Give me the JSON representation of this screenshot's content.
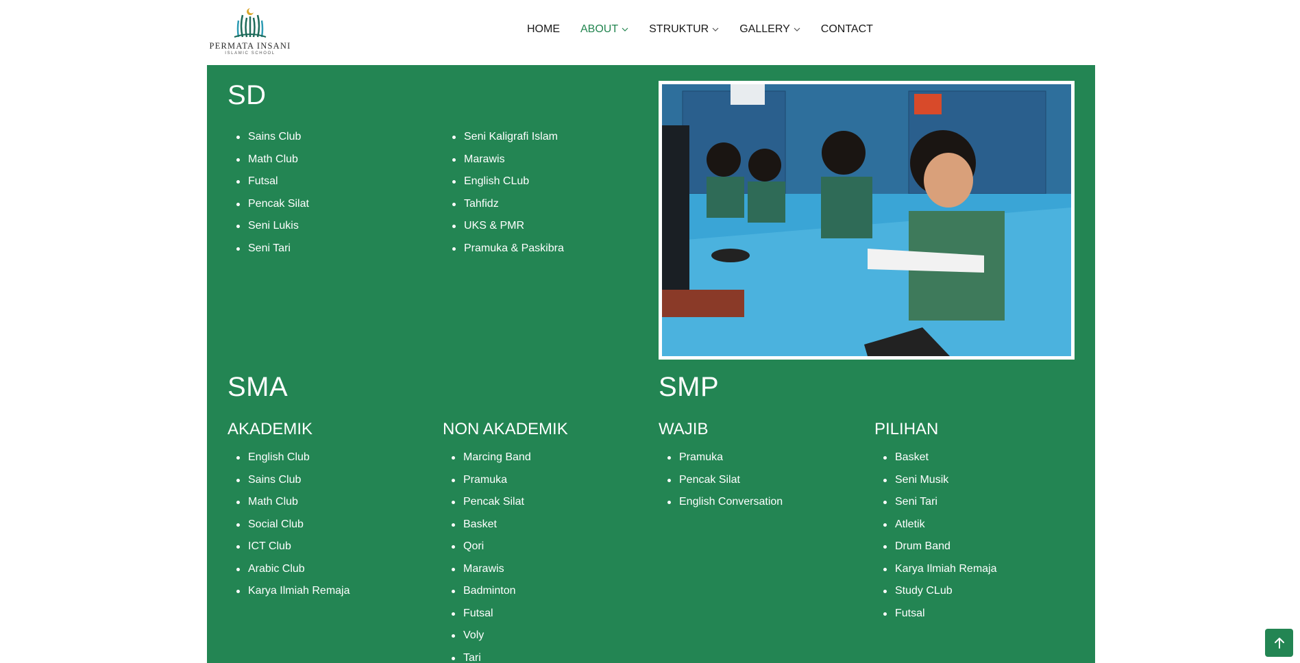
{
  "brand": {
    "name": "PERMATA INSANI",
    "subtitle": "ISLAMIC SCHOOL"
  },
  "nav": [
    {
      "label": "HOME"
    },
    {
      "label": "ABOUT"
    },
    {
      "label": "STRUKTUR"
    },
    {
      "label": "GALLERY"
    },
    {
      "label": "CONTACT"
    }
  ],
  "sd": {
    "title": "SD",
    "col1": [
      "Sains Club",
      "Math Club",
      "Futsal",
      "Pencak Silat",
      "Seni Lukis",
      "Seni Tari"
    ],
    "col2": [
      "Seni Kaligrafi Islam",
      "Marawis",
      "English CLub",
      "Tahfidz",
      "UKS & PMR",
      "Pramuka & Paskibra"
    ]
  },
  "sma": {
    "title": "SMA",
    "akademik": {
      "title": "AKADEMIK",
      "items": [
        "English Club",
        "Sains Club",
        "Math Club",
        "Social Club",
        "ICT Club",
        "Arabic Club",
        "Karya Ilmiah Remaja"
      ]
    },
    "non_akademik": {
      "title": "NON AKADEMIK",
      "items": [
        "Marcing Band",
        "Pramuka",
        "Pencak Silat",
        "Basket",
        "Qori",
        "Marawis",
        "Badminton",
        "Futsal",
        "Voly",
        "Tari"
      ]
    }
  },
  "smp": {
    "title": "SMP",
    "wajib": {
      "title": "WAJIB",
      "items": [
        "Pramuka",
        "Pencak Silat",
        "English Conversation"
      ]
    },
    "pilihan": {
      "title": "PILIHAN",
      "items": [
        "Basket",
        "Seni Musik",
        "Seni Tari",
        "Atletik",
        "Drum Band",
        "Karya Ilmiah Remaja",
        "Study CLub",
        "Futsal"
      ]
    }
  },
  "colors": {
    "panel": "#238553",
    "nav_active": "#22854f",
    "text": "#1a1a1a"
  },
  "icons": {
    "back_to_top": "arrow-up-icon",
    "dropdown": "chevron-down-icon"
  }
}
